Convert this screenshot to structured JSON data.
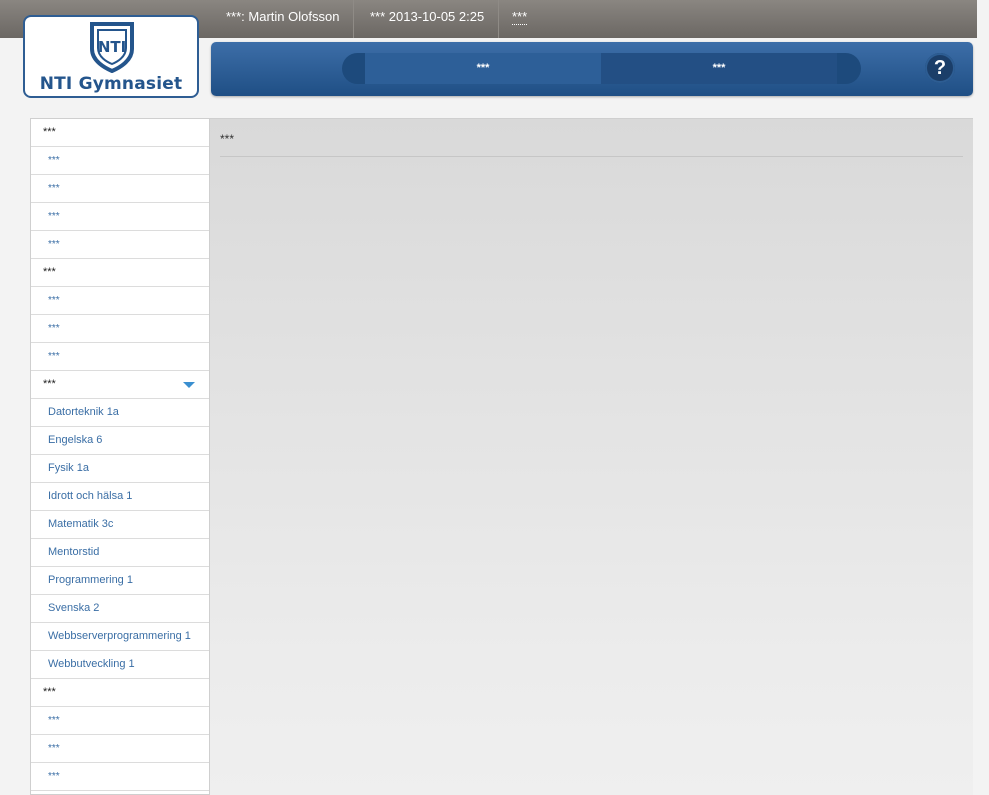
{
  "topbar": {
    "user": "***: Martin Olofsson",
    "login": "*** 2013-10-05 2:25",
    "logout": "***"
  },
  "logo": {
    "text": "NTI Gymnasiet"
  },
  "nav": {
    "tabs": [
      "***",
      "***"
    ],
    "help": "?"
  },
  "sidebar": {
    "items": [
      {
        "label": "***",
        "kind": "head"
      },
      {
        "label": "***",
        "kind": "sub"
      },
      {
        "label": "***",
        "kind": "sub"
      },
      {
        "label": "***",
        "kind": "sub"
      },
      {
        "label": "***",
        "kind": "sub"
      },
      {
        "label": "***",
        "kind": "head"
      },
      {
        "label": "***",
        "kind": "sub"
      },
      {
        "label": "***",
        "kind": "sub"
      },
      {
        "label": "***",
        "kind": "sub"
      },
      {
        "label": "***",
        "kind": "head",
        "expanded": true
      },
      {
        "label": "Datorteknik 1a",
        "kind": "course"
      },
      {
        "label": "Engelska 6",
        "kind": "course"
      },
      {
        "label": "Fysik 1a",
        "kind": "course"
      },
      {
        "label": "Idrott och hälsa 1",
        "kind": "course"
      },
      {
        "label": "Matematik 3c",
        "kind": "course"
      },
      {
        "label": "Mentorstid",
        "kind": "course"
      },
      {
        "label": "Programmering 1",
        "kind": "course"
      },
      {
        "label": "Svenska 2",
        "kind": "course"
      },
      {
        "label": "Webbserverprogrammering 1",
        "kind": "course"
      },
      {
        "label": "Webbutveckling 1",
        "kind": "course"
      },
      {
        "label": "***",
        "kind": "head"
      },
      {
        "label": "***",
        "kind": "sub"
      },
      {
        "label": "***",
        "kind": "sub"
      },
      {
        "label": "***",
        "kind": "sub"
      },
      {
        "label": "***",
        "kind": "sub"
      }
    ]
  },
  "main": {
    "title": "***"
  },
  "colors": {
    "accent": "#2e5d93",
    "link": "#3a6ea5"
  }
}
